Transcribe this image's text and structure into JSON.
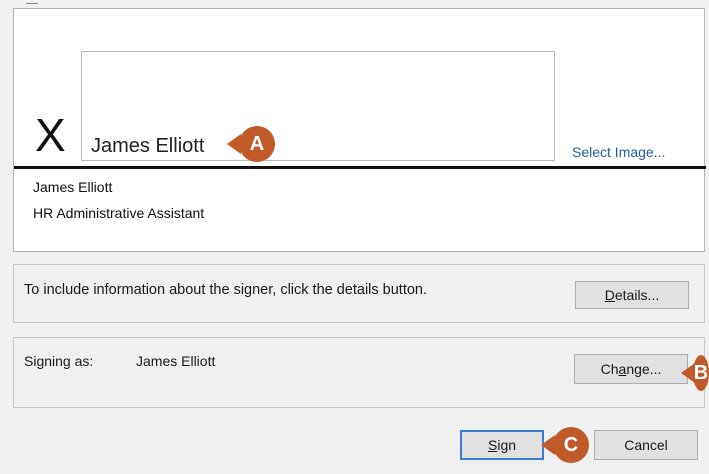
{
  "signature": {
    "x_mark": "X",
    "typed_name": "James Elliott",
    "select_image_label": "Select Image...",
    "signer_name": "James Elliott",
    "signer_title": "HR Administrative Assistant"
  },
  "info": {
    "text": "To include information about the signer, click the details button.",
    "details_button": "Details..."
  },
  "signing": {
    "label": "Signing as:",
    "name": "James Elliott",
    "change_button": "Change..."
  },
  "footer": {
    "sign_button": "Sign",
    "cancel_button": "Cancel"
  },
  "callouts": {
    "a": "A",
    "b": "B",
    "c": "C",
    "color": "#c05a28"
  }
}
